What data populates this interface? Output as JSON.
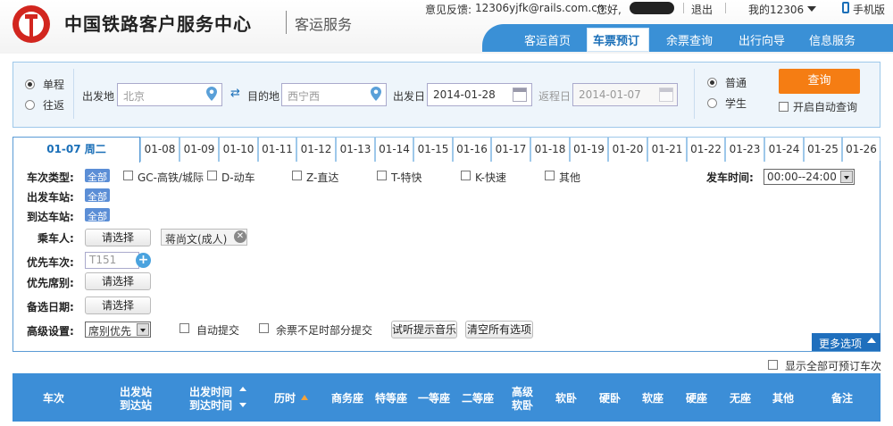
{
  "header": {
    "logo_title": "中国铁路客户服务中心",
    "logo_subtitle": "客运服务",
    "feedback_label": "意见反馈:",
    "feedback_email": "12306yjfk@rails.com.cn",
    "greeting": "您好,",
    "logout": "退出",
    "my12306": "我的12306",
    "mobile": "手机版"
  },
  "nav": {
    "items": [
      "客运首页",
      "车票预订",
      "余票查询",
      "出行向导",
      "信息服务"
    ],
    "active": "车票预订"
  },
  "search": {
    "trip_single": "单程",
    "trip_round": "往返",
    "from_label": "出发地",
    "from_value": "北京",
    "to_label": "目的地",
    "to_value": "西宁西",
    "depart_label": "出发日",
    "depart_value": "2014-01-28",
    "return_label": "返程日",
    "return_value": "2014-01-07",
    "ticket_normal": "普通",
    "ticket_student": "学生",
    "query_button": "查询",
    "auto_query": "开启自动查询"
  },
  "date_tabs": [
    "01-07 周二",
    "01-08",
    "01-09",
    "01-10",
    "01-11",
    "01-12",
    "01-13",
    "01-14",
    "01-15",
    "01-16",
    "01-17",
    "01-18",
    "01-19",
    "01-20",
    "01-21",
    "01-22",
    "01-23",
    "01-24",
    "01-25",
    "01-26"
  ],
  "filter": {
    "train_type_label": "车次类型:",
    "all": "全部",
    "train_types": [
      "GC-高铁/城际",
      "D-动车",
      "Z-直达",
      "T-特快",
      "K-快速",
      "其他"
    ],
    "depart_time_label": "发车时间:",
    "depart_time_value": "00:00--24:00",
    "from_station_label": "出发车站:",
    "to_station_label": "到达车站:",
    "passenger_label": "乘车人:",
    "select_button": "请选择",
    "passenger_tag": "蒋尚文(成人)",
    "priority_train_label": "优先车次:",
    "priority_train_placeholder": "T151",
    "priority_seat_label": "优先席别:",
    "backup_date_label": "备选日期:",
    "advanced_label": "高级设置:",
    "advanced_select": "席别优先",
    "auto_submit": "自动提交",
    "partial_submit": "余票不足时部分提交",
    "listen_music": "试听提示音乐",
    "clear_all": "清空所有选项",
    "more_options": "更多选项"
  },
  "show_all_label": "显示全部可预订车次",
  "table_headers": {
    "train": "车次",
    "stations": [
      "出发站",
      "到达站"
    ],
    "times": [
      "出发时间",
      "到达时间"
    ],
    "duration": "历时",
    "business": "商务座",
    "premium": "特等座",
    "first": "一等座",
    "second": "二等座",
    "deluxe_sleeper": [
      "高级",
      "软卧"
    ],
    "soft_sleeper": "软卧",
    "hard_sleeper": "硬卧",
    "soft_seat": "软座",
    "hard_seat": "硬座",
    "no_seat": "无座",
    "other": "其他",
    "remarks": "备注"
  }
}
